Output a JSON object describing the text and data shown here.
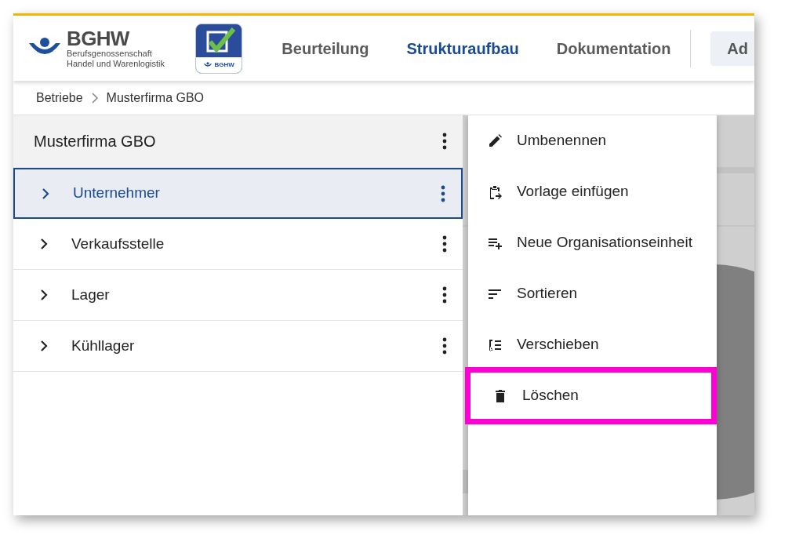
{
  "header": {
    "logo": {
      "name": "BGHW",
      "subtitle_lines": [
        "Berufsgenossenschaft",
        "Handel und Warenlogistik"
      ]
    },
    "app_icon": {
      "label": "BGHW"
    },
    "nav": [
      {
        "label": "Beurteilung",
        "selected": false
      },
      {
        "label": "Strukturaufbau",
        "selected": true
      },
      {
        "label": "Dokumentation",
        "selected": false
      }
    ],
    "button": {
      "label": "Ad"
    }
  },
  "breadcrumb": [
    "Betriebe",
    "Musterfirma GBO"
  ],
  "panel": {
    "title": "Musterfirma GBO",
    "items": [
      {
        "label": "Unternehmer",
        "selected": true
      },
      {
        "label": "Verkaufsstelle",
        "selected": false
      },
      {
        "label": "Lager",
        "selected": false
      },
      {
        "label": "Kühllager",
        "selected": false
      }
    ]
  },
  "context_menu": {
    "items": [
      {
        "kind": "edit",
        "label": "Umbenennen",
        "highlighted": false
      },
      {
        "kind": "paste",
        "label": "Vorlage einfügen",
        "highlighted": false
      },
      {
        "kind": "add",
        "label": "Neue Organisationseinheit",
        "highlighted": false
      },
      {
        "kind": "sort",
        "label": "Sortieren",
        "highlighted": false
      },
      {
        "kind": "move",
        "label": "Verschieben",
        "highlighted": false
      },
      {
        "kind": "delete",
        "label": "Löschen",
        "highlighted": true
      }
    ]
  }
}
